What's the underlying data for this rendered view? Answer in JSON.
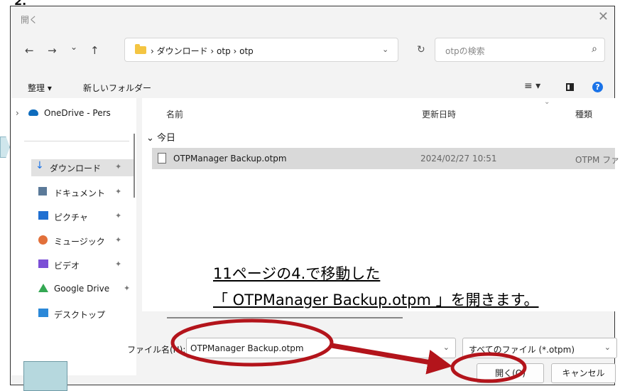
{
  "page": {
    "corner_label": "2."
  },
  "dialog": {
    "title": "開く",
    "close_glyph": "✕"
  },
  "nav": {
    "back": "←",
    "forward": "→",
    "recent": "⌄",
    "up": "↑",
    "breadcrumb": "›  ダウンロード  ›  otp  ›  otp",
    "dropdown": "⌄",
    "refresh": "↻",
    "search_placeholder": "otpの検索",
    "search_glyph": "⌕"
  },
  "commandbar": {
    "organize": "整理 ▾",
    "new_folder": "新しいフォルダー",
    "view_glyph": "≡ ▾",
    "help_glyph": "?"
  },
  "sidebar": {
    "items": [
      {
        "label": "OneDrive - Pers",
        "icon": "cloud-icon",
        "color": "#0f6cbd",
        "pin": "",
        "chevron": "›"
      },
      {
        "label": "ダウンロード",
        "icon": "download-icon",
        "color": "#1a73e8",
        "pin": "✦",
        "selected": true
      },
      {
        "label": "ドキュメント",
        "icon": "document-icon",
        "color": "#5b7a99",
        "pin": "✦"
      },
      {
        "label": "ピクチャ",
        "icon": "picture-icon",
        "color": "#1f6fd1",
        "pin": "✦"
      },
      {
        "label": "ミュージック",
        "icon": "music-icon",
        "color": "#e2703a",
        "pin": "✦"
      },
      {
        "label": "ビデオ",
        "icon": "video-icon",
        "color": "#7b4fd6",
        "pin": "✦"
      },
      {
        "label": "Google Drive",
        "icon": "google-drive-icon",
        "color": "#34a853",
        "pin": "✦"
      },
      {
        "label": "デスクトップ",
        "icon": "desktop-icon",
        "color": "#2b88d8",
        "pin": ""
      }
    ]
  },
  "list": {
    "columns": {
      "name": "名前",
      "modified": "更新日時",
      "type": "種類"
    },
    "sort_glyph": "⌄",
    "group": "⌄ 今日",
    "files": [
      {
        "name": "OTPManager Backup.otpm",
        "modified": "2024/02/27 10:51",
        "type": "OTPM ファイル"
      }
    ]
  },
  "annotation": {
    "line1": "11ページの4.で移動した",
    "line2": "「 OTPManager Backup.otpm 」を開きます。"
  },
  "footer": {
    "filename_label": "ファイル名(N):",
    "filename_value": "OTPManager Backup.otpm",
    "filter_value": "すべてのファイル (*.otpm)",
    "dropdown": "⌄",
    "open_label": "開く(O)",
    "cancel_label": "キャンセル"
  },
  "colors": {
    "highlight": "#b3141b"
  }
}
